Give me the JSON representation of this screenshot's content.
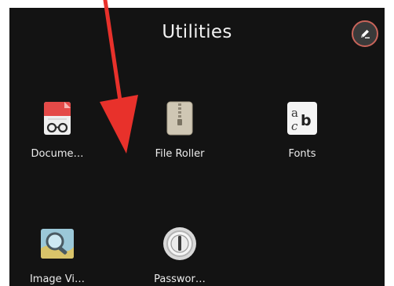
{
  "folder": {
    "title": "Utilities",
    "edit_icon": "pencil-icon",
    "accent": "#c8645a"
  },
  "apps": [
    {
      "label": "Docume…",
      "icon": "document-viewer-icon"
    },
    {
      "label": "File Roller",
      "icon": "archive-zipper-icon"
    },
    {
      "label": "Fonts",
      "icon": "fonts-icon"
    },
    {
      "label": "Image Vi…",
      "icon": "image-viewer-icon"
    },
    {
      "label": "Passwor…",
      "icon": "password-lock-icon"
    }
  ],
  "annotation": {
    "arrow_color": "#e8312b"
  }
}
